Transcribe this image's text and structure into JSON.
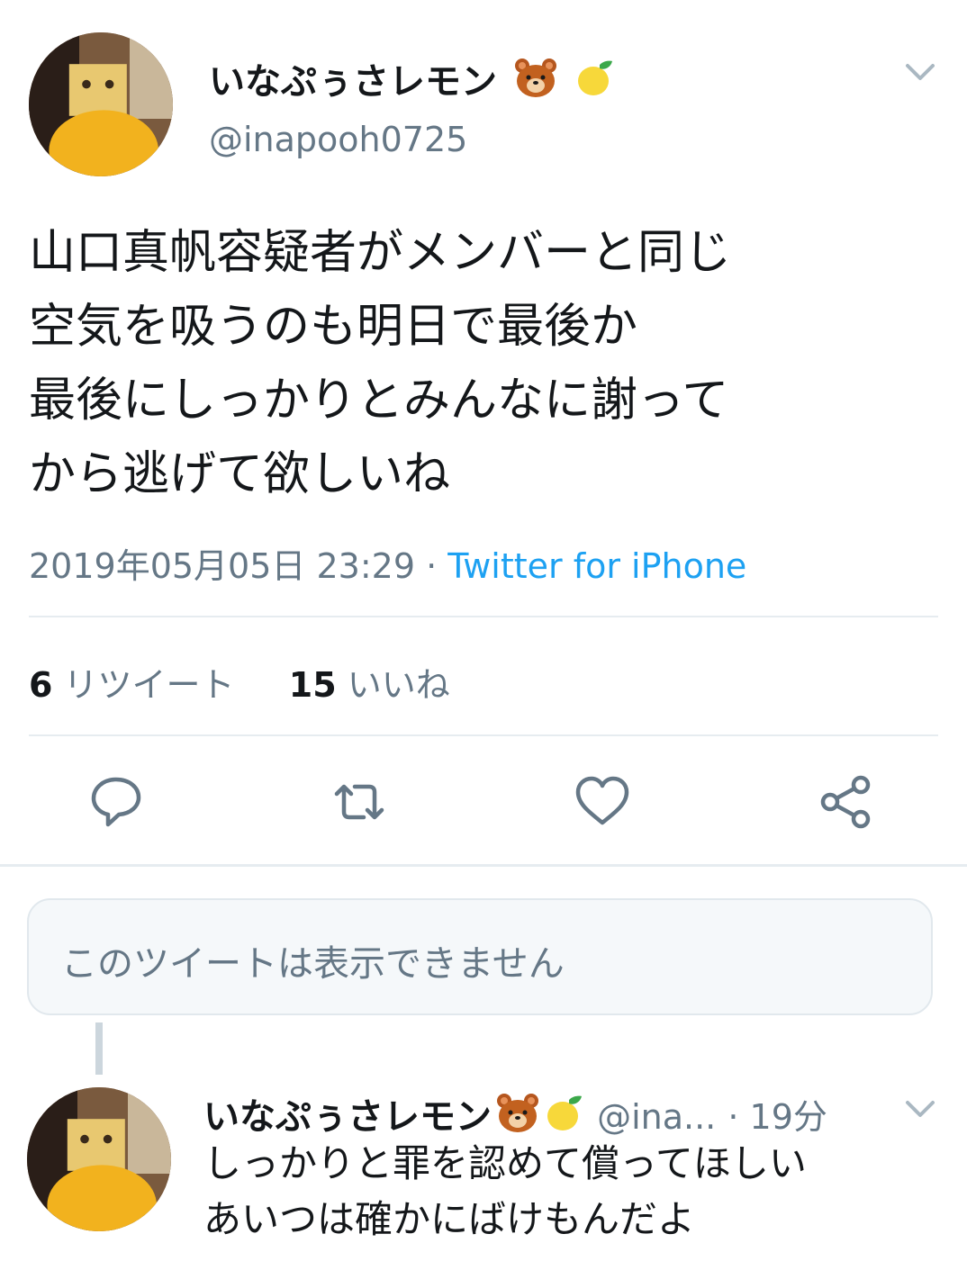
{
  "tweet": {
    "display_name": "いなぷぅさレモン",
    "handle": "@inapooh0725",
    "text_lines": [
      "山口真帆容疑者がメンバーと同じ",
      "空気を吸うのも明日で最後か",
      "最後にしっかりとみんなに謝って",
      "から逃げて欲しいね"
    ],
    "timestamp": "2019年05月05日 23:29",
    "separator": " · ",
    "source": "Twitter for iPhone",
    "retweets": {
      "count": "6",
      "label": "リツイート"
    },
    "likes": {
      "count": "15",
      "label": "いいね"
    },
    "icons": [
      "reply-icon",
      "retweet-icon",
      "like-icon",
      "share-icon"
    ]
  },
  "unavailable": {
    "text": "このツイートは表示できません"
  },
  "reply": {
    "display_name": "いなぷぅさレモン",
    "handle": "@ina...",
    "time": "· 19分",
    "text_lines": [
      "しっかりと罪を認めて償ってほしい",
      "あいつは確かにばけもんだよ"
    ]
  },
  "colors": {
    "accent": "#1da1f2",
    "secondary_text": "#657786",
    "divider": "#e6ecf0"
  }
}
